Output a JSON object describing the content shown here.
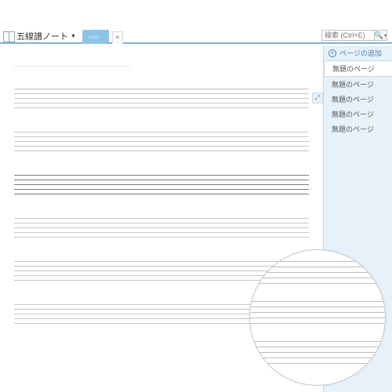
{
  "notebook": {
    "title": "五線譜ノート"
  },
  "section_tab": {
    "label": "○○○"
  },
  "search": {
    "placeholder": "検索 (Ctrl+E)"
  },
  "sidebar": {
    "add_page_label": "ページの追加",
    "pages": [
      "無題のページ",
      "無題のページ",
      "無題のページ",
      "無題のページ",
      "無題のページ"
    ]
  }
}
